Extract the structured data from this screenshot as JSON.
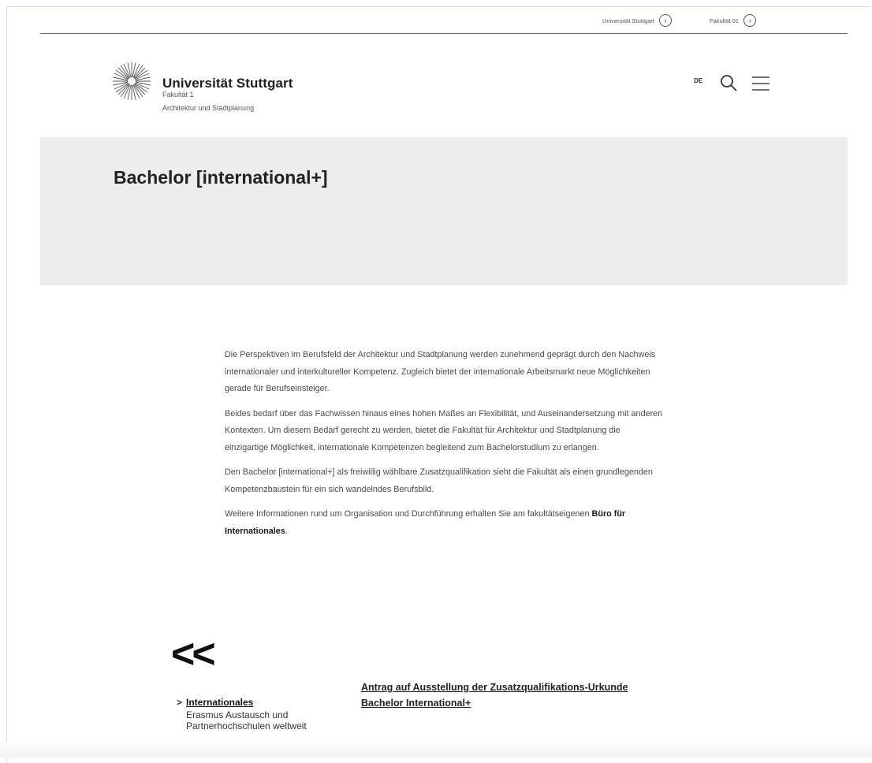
{
  "top_links": [
    {
      "label": "Universität Stuttgart"
    },
    {
      "label": "Fakultät 01"
    }
  ],
  "header": {
    "brand_title": "Universität Stuttgart",
    "brand_sub1": "Fakultät 1",
    "brand_sub2": "Architektur und Stadtplanung",
    "lang": "DE"
  },
  "hero": {
    "title": "Bachelor [international+]"
  },
  "content": {
    "p1": "Die Perspektiven im Berufsfeld der Architektur und Stadtplanung werden zunehmend geprägt durch den Nachweis internationaler und interkultureller Kompetenz. Zugleich bietet der internationale Arbeitsmarkt neue Möglichkeiten gerade für Berufseinsteiger.",
    "p2": "Beides bedarf über das Fachwissen hinaus eines hohen Maßes an Flexibilität, und Auseinandersetzung mit anderen Kontexten. Um diesem Bedarf gerecht zu werden, bietet die Fakultät für Architektur und Stadtplanung die einzigartige Möglichkeit, internationale Kompetenzen begleitend zum Bachelorstudium zu erlangen.",
    "p3": "Den Bachelor [international+] als freiwillig wählbare Zusatzqualifikation sieht die Fakultät als einen grundlegenden Kompetenzbaustein für ein sich wandelndes Berufsbild.",
    "p4_pre": "Weitere Informationen rund um Organisation und Durchführung erhalten Sie am fakultätseigenen ",
    "p4_link": "Büro für Internationales",
    "p4_post": "."
  },
  "back": {
    "label": "<<"
  },
  "related": {
    "chevron": ">",
    "title": "Internationales",
    "desc": "Erasmus Austausch und Partnerhochschulen weltweit"
  },
  "antrag": {
    "label": "Antrag auf Ausstellung der Zusatzqualifikations-Urkunde Bachelor International+"
  },
  "icons": {
    "top_link_arrow": "circle-arrow-right-icon",
    "search": "search-icon",
    "menu": "hamburger-menu-icon",
    "logo": "university-logo"
  },
  "colors": {
    "hero_bg": "#ededed",
    "text": "#1a1a1a"
  }
}
